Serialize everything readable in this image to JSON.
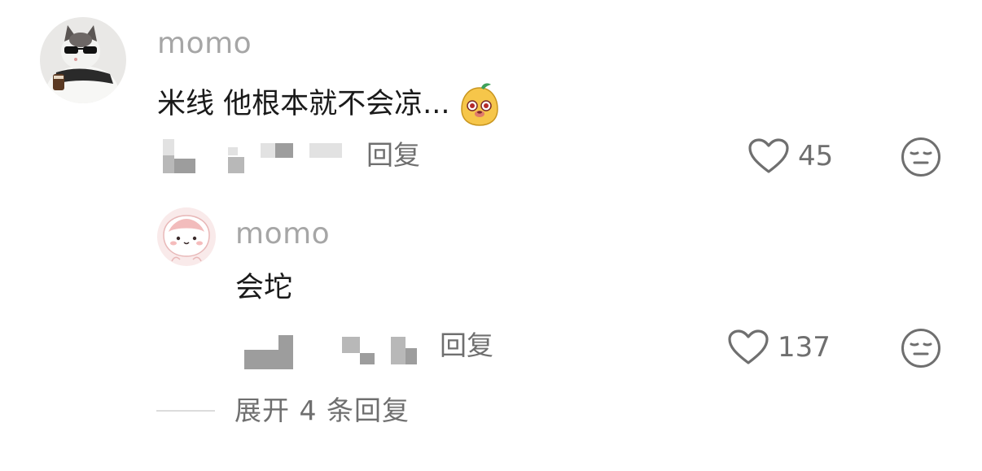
{
  "comment": {
    "username": "momo",
    "text": "米线  他根本就不会凉...",
    "reply_label": "回复",
    "like_count": "45"
  },
  "reply": {
    "username": "momo",
    "text": "会坨",
    "reply_label": "回复",
    "like_count": "137"
  },
  "expand": {
    "label": "展开 4 条回复"
  },
  "icons": {
    "like": "heart-outline-icon",
    "dislike": "neutral-face-icon",
    "emoji": "yellow-blob-emoji"
  },
  "colors": {
    "username": "#a6a6a6",
    "secondary_text": "#6f6f6f",
    "primary_text": "#1a1a1a"
  }
}
